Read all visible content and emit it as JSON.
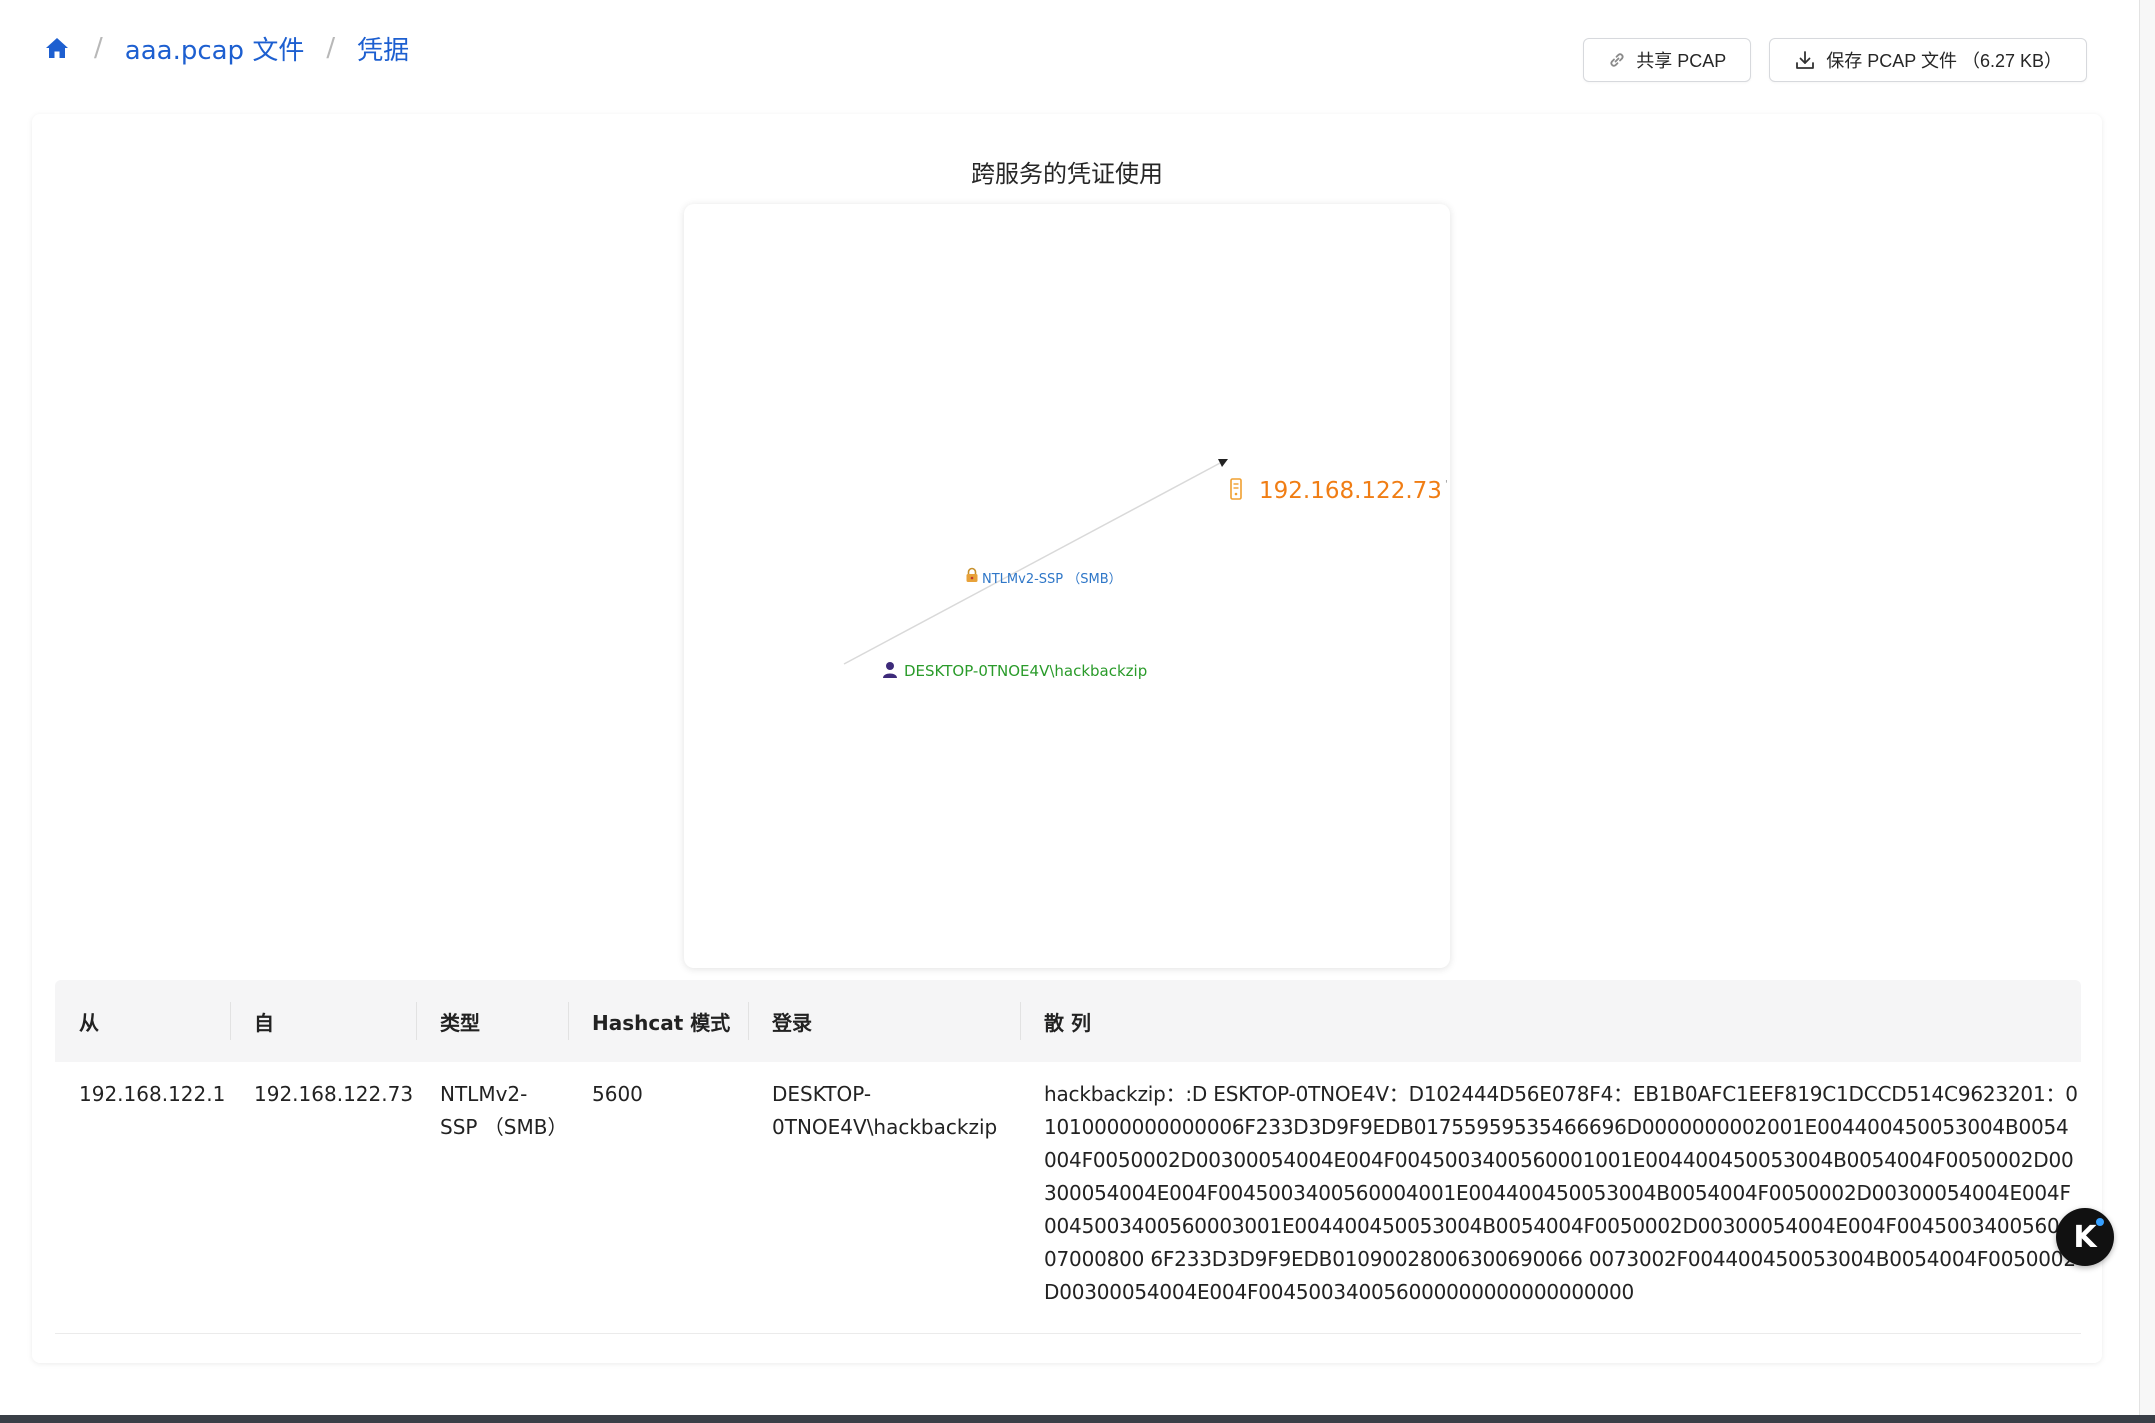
{
  "breadcrumb": {
    "home_icon": "home-icon",
    "separator": "/",
    "items": [
      {
        "label": "aaa.pcap 文件"
      },
      {
        "label": "凭据"
      }
    ]
  },
  "actions": {
    "share": {
      "label": "共享 PCAP",
      "icon": "link-icon"
    },
    "save": {
      "label": "保存 PCAP 文件 （6.27 KB）",
      "icon": "download-icon"
    }
  },
  "graph": {
    "title": "跨服务的凭证使用",
    "server_node": {
      "label": "192.168.122.73",
      "icon": "server-icon",
      "color": "#f07d14"
    },
    "edge": {
      "label": "NTLMv2-SSP （SMB）",
      "icon": "lock-icon",
      "color": "#2f77c8"
    },
    "user_node": {
      "label": "DESKTOP-0TNOE4V\\hackbackzip",
      "icon": "user-icon",
      "color": "#2a9b2a"
    }
  },
  "table": {
    "columns": [
      "从",
      "自",
      "类型",
      "Hashcat 模式",
      "登录",
      "散 列"
    ],
    "rows": [
      {
        "from": "192.168.122.1",
        "to": "192.168.122.73",
        "type": "NTLMv2-SSP （SMB）",
        "hashcat_mode": "5600",
        "login": "DESKTOP-0TNOE4V\\hackbackzip",
        "hash": "hackbackzip：:D ESKTOP-0TNOE4V：D102444D56E078F4：EB1B0AFC1EEF819C1DCCD514C9623201：01010000000000006F233D3D9F9EDB01755959535466696D0000000002001E004400450053004B0054004F0050002D00300054004E004F0045003400560001001E004400450053004B0054004F0050002D00300054004E004F0045003400560004001E004400450053004B0054004F0050002D00300054004E004F0045003400560003001E004400450053004B0054004F0050002D00300054004E004F0045003400560007000800 6F233D3D9F9EDB01090028006300690066 0073002F004400450053004B0054004F0050002D00300054004E004F004500340056000000000000000000"
      }
    ]
  },
  "floating_badge": {
    "label": "K",
    "icon": "assistant-icon"
  }
}
